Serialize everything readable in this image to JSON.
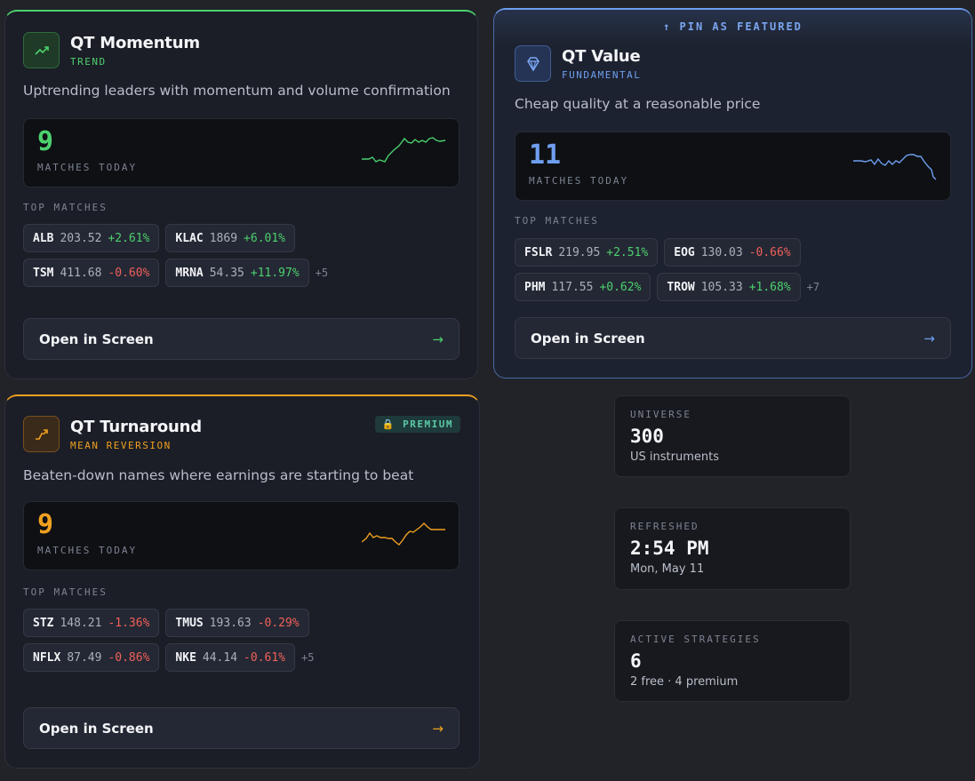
{
  "strategies": [
    {
      "title": "QT Momentum",
      "tag": "TREND",
      "description": "Uptrending leaders with momentum and volume confirmation",
      "match_count": "9",
      "match_label": "MATCHES TODAY",
      "top_label": "TOP MATCHES",
      "matches": [
        {
          "ticker": "ALB",
          "price": "203.52",
          "change": "+2.61%"
        },
        {
          "ticker": "KLAC",
          "price": "1869",
          "change": "+6.01%"
        },
        {
          "ticker": "TSM",
          "price": "411.68",
          "change": "-0.60%"
        },
        {
          "ticker": "MRNA",
          "price": "54.35",
          "change": "+11.97%"
        }
      ],
      "more": "+5",
      "open_label": "Open in Screen",
      "arrow": "→",
      "accent": "#4cd06e"
    },
    {
      "title": "QT Value",
      "tag": "FUNDAMENTAL",
      "pin_label": "↑ PIN AS FEATURED",
      "description": "Cheap quality at a reasonable price",
      "match_count": "11",
      "match_label": "MATCHES TODAY",
      "top_label": "TOP MATCHES",
      "matches": [
        {
          "ticker": "FSLR",
          "price": "219.95",
          "change": "+2.51%"
        },
        {
          "ticker": "EOG",
          "price": "130.03",
          "change": "-0.66%"
        },
        {
          "ticker": "PHM",
          "price": "117.55",
          "change": "+0.62%"
        },
        {
          "ticker": "TROW",
          "price": "105.33",
          "change": "+1.68%"
        }
      ],
      "more": "+7",
      "open_label": "Open in Screen",
      "arrow": "→",
      "accent": "#6e9ff0"
    },
    {
      "title": "QT Turnaround",
      "tag": "MEAN REVERSION",
      "badge": "🔒 PREMIUM",
      "description": "Beaten-down names where earnings are starting to beat",
      "match_count": "9",
      "match_label": "MATCHES TODAY",
      "top_label": "TOP MATCHES",
      "matches": [
        {
          "ticker": "STZ",
          "price": "148.21",
          "change": "-1.36%"
        },
        {
          "ticker": "TMUS",
          "price": "193.63",
          "change": "-0.29%"
        },
        {
          "ticker": "NFLX",
          "price": "87.49",
          "change": "-0.86%"
        },
        {
          "ticker": "NKE",
          "price": "44.14",
          "change": "-0.61%"
        }
      ],
      "more": "+5",
      "open_label": "Open in Screen",
      "arrow": "→",
      "accent": "#f0a020"
    }
  ],
  "stats": {
    "universe": {
      "label": "UNIVERSE",
      "value": "300",
      "sub": "US instruments"
    },
    "refreshed": {
      "label": "REFRESHED",
      "value": "2:54 PM",
      "sub": "Mon, May 11"
    },
    "active": {
      "label": "ACTIVE STRATEGIES",
      "value": "6",
      "sub": "2 free · 4 premium"
    }
  },
  "icons": {
    "momentum": "trending-up-icon",
    "value": "diamond-icon",
    "turnaround": "reversal-arrow-icon",
    "premium": "lock-icon"
  }
}
